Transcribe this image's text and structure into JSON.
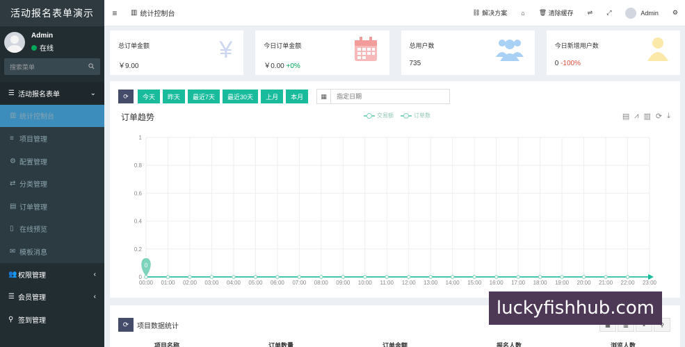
{
  "app": {
    "title": "活动报名表单演示"
  },
  "user": {
    "name": "Admin",
    "status": "在线"
  },
  "search": {
    "placeholder": "搜索菜单"
  },
  "menu": {
    "section1": "活动报名表单",
    "items": [
      {
        "label": "统计控制台",
        "icon": "bar-chart-icon",
        "active": true
      },
      {
        "label": "项目管理",
        "icon": "list-icon"
      },
      {
        "label": "配置管理",
        "icon": "gear-icon"
      },
      {
        "label": "分类管理",
        "icon": "shuffle-icon"
      },
      {
        "label": "订单管理",
        "icon": "file-icon"
      },
      {
        "label": "在线预览",
        "icon": "mobile-icon"
      },
      {
        "label": "模板消息",
        "icon": "envelope-icon"
      }
    ],
    "section2": "权限管理",
    "section3": "会员管理",
    "section4": "签到管理"
  },
  "topbar": {
    "breadcrumb": "统计控制台",
    "solutions": "解决方案",
    "clear_cache": "清除缓存",
    "user": "Admin"
  },
  "stats": [
    {
      "label": "总订单金额",
      "value": "￥9.00",
      "icon": "yen-icon",
      "color": "#cdd6f0"
    },
    {
      "label": "今日订单金额",
      "value": "￥0.00",
      "change": "+0%",
      "icon": "calendar-icon",
      "color": "#f7b9b9"
    },
    {
      "label": "总用户数",
      "value": "735",
      "icon": "users-icon",
      "color": "#a9d0f5"
    },
    {
      "label": "今日新增用户数",
      "value": "0",
      "change": "-100%",
      "icon": "user-icon",
      "color": "#fbe9a9"
    }
  ],
  "toolbar": {
    "buttons": [
      "今天",
      "昨天",
      "最近7天",
      "最近30天",
      "上月",
      "本月"
    ],
    "date_placeholder": "指定日期"
  },
  "chart_data": {
    "type": "line",
    "title": "订单趋势",
    "legend": [
      "交易额",
      "订单数"
    ],
    "x": [
      "00:00",
      "01:00",
      "02:00",
      "03:00",
      "04:00",
      "05:00",
      "06:00",
      "07:00",
      "08:00",
      "09:00",
      "10:00",
      "11:00",
      "12:00",
      "13:00",
      "14:00",
      "15:00",
      "16:00",
      "17:00",
      "18:00",
      "19:00",
      "20:00",
      "21:00",
      "22:00",
      "23:00"
    ],
    "series": [
      {
        "name": "交易额",
        "values": [
          0,
          0,
          0,
          0,
          0,
          0,
          0,
          0,
          0,
          0,
          0,
          0,
          0,
          0,
          0,
          0,
          0,
          0,
          0,
          0,
          0,
          0,
          0,
          0
        ]
      },
      {
        "name": "订单数",
        "values": [
          0,
          0,
          0,
          0,
          0,
          0,
          0,
          0,
          0,
          0,
          0,
          0,
          0,
          0,
          0,
          0,
          0,
          0,
          0,
          0,
          0,
          0,
          0,
          0
        ]
      }
    ],
    "yticks": [
      "0",
      "0.2",
      "0.4",
      "0.6",
      "0.8",
      "1"
    ],
    "ylim": [
      0,
      1
    ],
    "marker_label": "0",
    "grid": true,
    "legend_position": "top-center",
    "line_color": "#18bc9c"
  },
  "project_panel": {
    "title": "项目数据统计",
    "columns": [
      "项目名称",
      "订单数量",
      "订单金额",
      "报名人数",
      "浏览人数"
    ]
  },
  "watermark": "luckyfishhub.com"
}
